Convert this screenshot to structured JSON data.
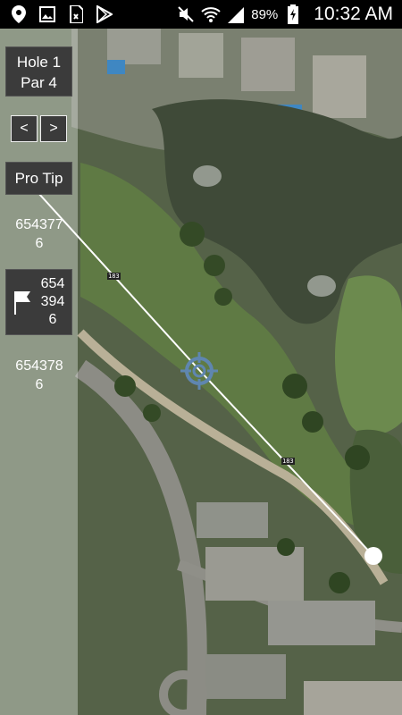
{
  "status_bar": {
    "icons_left": [
      "location-icon",
      "image-icon",
      "sim-icon",
      "play-store-icon"
    ],
    "battery_percent": "89%",
    "time": "10:32 AM"
  },
  "hole": {
    "label": "Hole 1",
    "par": "Par 4"
  },
  "nav": {
    "prev": "<",
    "next": ">"
  },
  "pro_tip": "Pro Tip",
  "distances": {
    "tee_to_target": "654377 6",
    "flag_line1": "654",
    "flag_line2": "394",
    "flag_line3": "6",
    "target_to_ball": "654378 6"
  },
  "yard_markers": {
    "first": "183",
    "second": "183"
  },
  "colors": {
    "panel_box": "#3b3b3b",
    "line": "#ffffff",
    "target": "#5f86b0"
  }
}
